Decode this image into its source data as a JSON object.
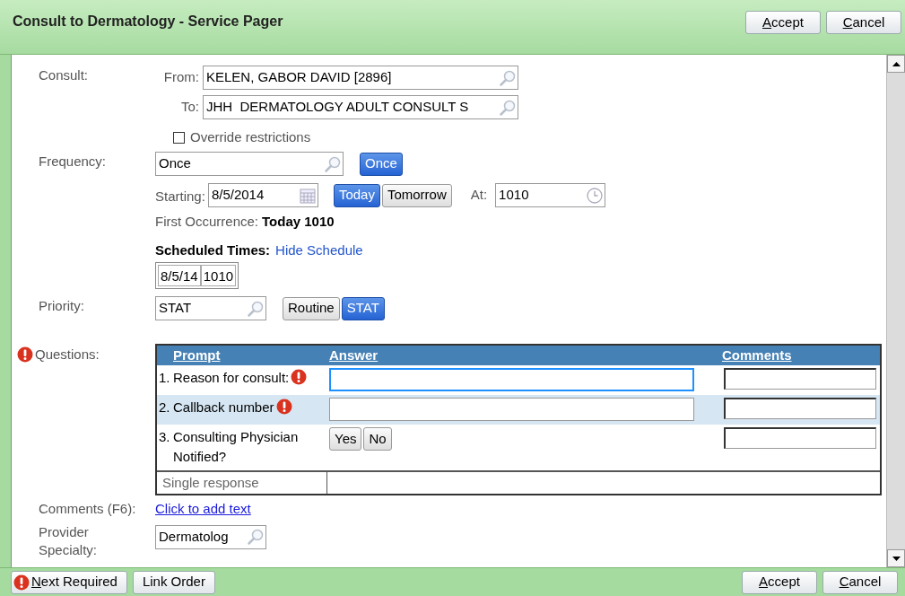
{
  "window": {
    "title": "Consult to Dermatology - Service Pager"
  },
  "header_buttons": [
    {
      "label": "Accept"
    },
    {
      "label": "Cancel"
    }
  ],
  "consult": {
    "label": "Consult:",
    "from": {
      "label": "From:",
      "value": "KELEN, GABOR DAVID [2896]"
    },
    "to": {
      "label": "To:",
      "value": "JHH  DERMATOLOGY ADULT CONSULT S"
    }
  },
  "override": {
    "label": "Override restrictions",
    "checked": false
  },
  "frequency": {
    "label": "Frequency:",
    "value": "Once",
    "options": [
      {
        "label": "Once",
        "selected": true
      }
    ]
  },
  "starting": {
    "label": "Starting:",
    "value": "8/5/2014",
    "options": [
      {
        "label": "Today",
        "selected": true
      },
      {
        "label": "Tomorrow",
        "selected": false
      }
    ],
    "at_label": "At:",
    "at_value": "1010"
  },
  "first_occurrence": {
    "label": "First Occurrence:",
    "value": "Today 1010"
  },
  "scheduled_times": {
    "label": "Scheduled Times:",
    "link": "Hide Schedule",
    "times": [
      {
        "date": "8/5/14",
        "time": "1010"
      }
    ]
  },
  "priority": {
    "label": "Priority:",
    "value": "STAT",
    "options": [
      {
        "label": "Routine",
        "selected": false
      },
      {
        "label": "STAT",
        "selected": true
      }
    ]
  },
  "questions": {
    "label": "Questions:",
    "required": true,
    "columns": [
      "Prompt",
      "Answer",
      "Comments"
    ],
    "rows": [
      {
        "number": "1.",
        "prompt": "Reason for consult:",
        "required": true,
        "kind": "text",
        "focused": true,
        "selected": false
      },
      {
        "number": "2.",
        "prompt": "Callback number",
        "required": true,
        "kind": "text",
        "focused": false,
        "selected": true
      },
      {
        "number": "3.",
        "prompt": "Consulting Physician Notified?",
        "required": false,
        "kind": "choice",
        "options": [
          "Yes",
          "No"
        ],
        "selected": false
      }
    ],
    "footer": "Single response"
  },
  "comments": {
    "label": "Comments (F6):",
    "link": "Click to add text"
  },
  "provider_specialty": {
    "label": "Provider Specialty:",
    "value": "Dermatolog"
  },
  "footer_left": [
    {
      "label": "Next Required",
      "kind": "required"
    },
    {
      "label": "Link Order",
      "kind": "plain"
    }
  ],
  "footer_right": [
    {
      "label": "Accept"
    },
    {
      "label": "Cancel"
    }
  ]
}
